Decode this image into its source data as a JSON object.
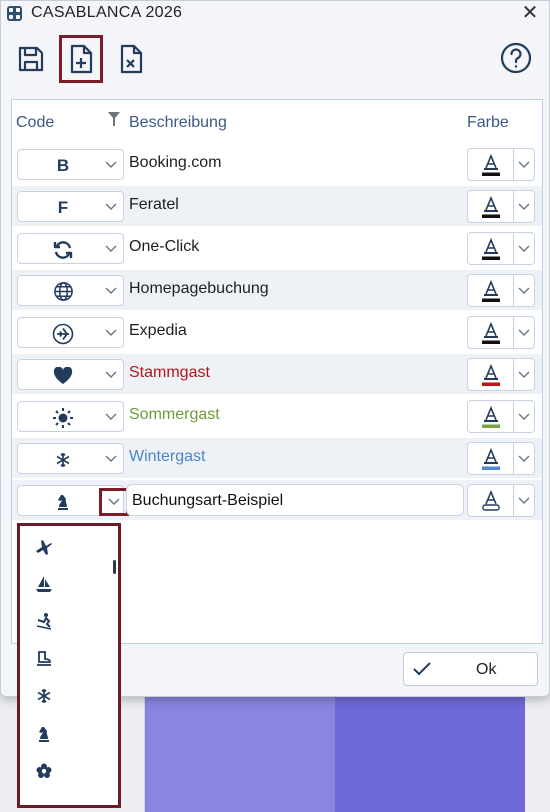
{
  "window": {
    "title": "CASABLANCA 2026",
    "close_glyph": "✕"
  },
  "toolbar": {
    "buttons": [
      {
        "name": "save-icon"
      },
      {
        "name": "new-document-icon"
      },
      {
        "name": "delete-document-icon"
      }
    ],
    "help": "help-icon"
  },
  "table": {
    "headers": {
      "code": "Code",
      "description": "Beschreibung",
      "color": "Farbe"
    },
    "rows": [
      {
        "code_icon": "B",
        "icon_name": "booking-icon",
        "description": "Booking.com",
        "text_color": "#1f1f1f",
        "underline_color": "#111111"
      },
      {
        "code_icon": "F",
        "icon_name": "feratel-icon",
        "description": "Feratel",
        "text_color": "#1f1f1f",
        "underline_color": "#111111"
      },
      {
        "code_icon": "",
        "icon_name": "refresh-icon",
        "description": "One-Click",
        "text_color": "#1f1f1f",
        "underline_color": "#111111"
      },
      {
        "code_icon": "",
        "icon_name": "globe-icon",
        "description": "Homepagebuchung",
        "text_color": "#1f1f1f",
        "underline_color": "#111111"
      },
      {
        "code_icon": "",
        "icon_name": "plane-circle-icon",
        "description": "Expedia",
        "text_color": "#1f1f1f",
        "underline_color": "#111111"
      },
      {
        "code_icon": "",
        "icon_name": "heart-icon",
        "description": "Stammgast",
        "text_color": "#b5161c",
        "underline_color": "#c0141c"
      },
      {
        "code_icon": "",
        "icon_name": "sun-icon",
        "description": "Sommergast",
        "text_color": "#6f9a3a",
        "underline_color": "#7aa544"
      },
      {
        "code_icon": "",
        "icon_name": "snowflake-icon",
        "description": "Wintergast",
        "text_color": "#4a86c8",
        "underline_color": "#4b8ad0"
      }
    ],
    "edit_row": {
      "icon_name": "chess-knight-icon",
      "value": "Buchungsart-Beispiel"
    }
  },
  "ok_button": {
    "label": "Ok"
  },
  "dropdown": {
    "items": [
      "airplane-icon",
      "sailboat-icon",
      "skier-icon",
      "ice-skate-icon",
      "snowflake-icon",
      "chess-knight-icon",
      "flower-icon"
    ]
  },
  "colors": {
    "accent": "#7a1d2b",
    "border": "#b9d0ea",
    "icon": "#233b5c"
  }
}
